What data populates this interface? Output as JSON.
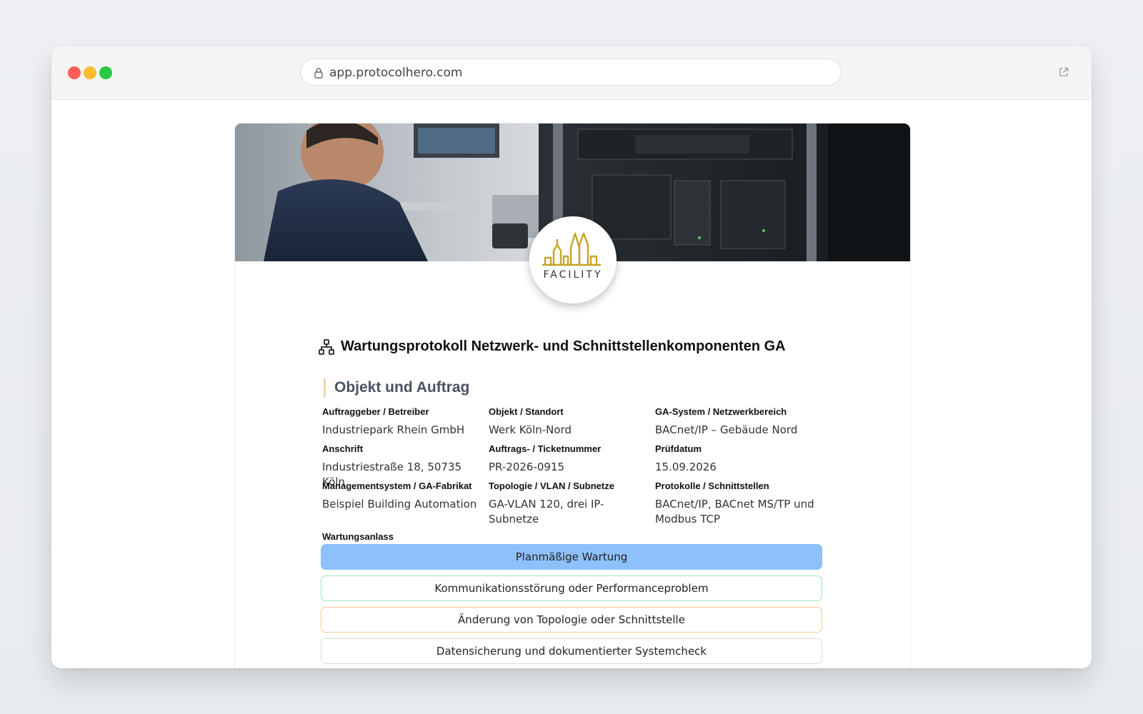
{
  "browser": {
    "url": "app.protocolhero.com"
  },
  "logo": {
    "text": "FACILITY"
  },
  "document": {
    "title": "Wartungsprotokoll Netzwerk- und Schnittstellenkomponenten GA"
  },
  "section": {
    "title": "Objekt und Auftrag",
    "fields": [
      {
        "label": "Auftraggeber / Betreiber",
        "value": "Industriepark Rhein GmbH"
      },
      {
        "label": "Objekt / Standort",
        "value": "Werk Köln-Nord"
      },
      {
        "label": "GA-System / Netzwerkbereich",
        "value": "BACnet/IP – Gebäude Nord"
      },
      {
        "label": "Anschrift",
        "value": "Industriestraße 18, 50735 Köln"
      },
      {
        "label": "Auftrags- / Ticketnummer",
        "value": "PR-2026-0915"
      },
      {
        "label": "Prüfdatum",
        "value": "15.09.2026"
      },
      {
        "label": "Managementsystem / GA-Fabrikat",
        "value": "Beispiel Building Automation"
      },
      {
        "label": "Topologie / VLAN / Subnetze",
        "value": "GA-VLAN 120, drei IP-Subnetze"
      },
      {
        "label": "Protokolle / Schnittstellen",
        "value": "BACnet/IP, BACnet MS/TP und Modbus TCP"
      }
    ]
  },
  "wartungsanlass": {
    "label": "Wartungsanlass",
    "options": [
      {
        "label": "Planmäßige Wartung",
        "selected": true,
        "color": "#8ec1fb"
      },
      {
        "label": "Kommunikationsstörung oder Performanceproblem",
        "selected": false,
        "color": "#9fe3c0"
      },
      {
        "label": "Änderung von Topologie oder Schnittstelle",
        "selected": false,
        "color": "#f7c98a"
      },
      {
        "label": "Datensicherung und dokumentierter Systemcheck",
        "selected": false,
        "color": "#d8dbe0"
      }
    ]
  },
  "colors": {
    "accent_blue": "#8ec1fb",
    "logo_gold": "#c9a227"
  }
}
